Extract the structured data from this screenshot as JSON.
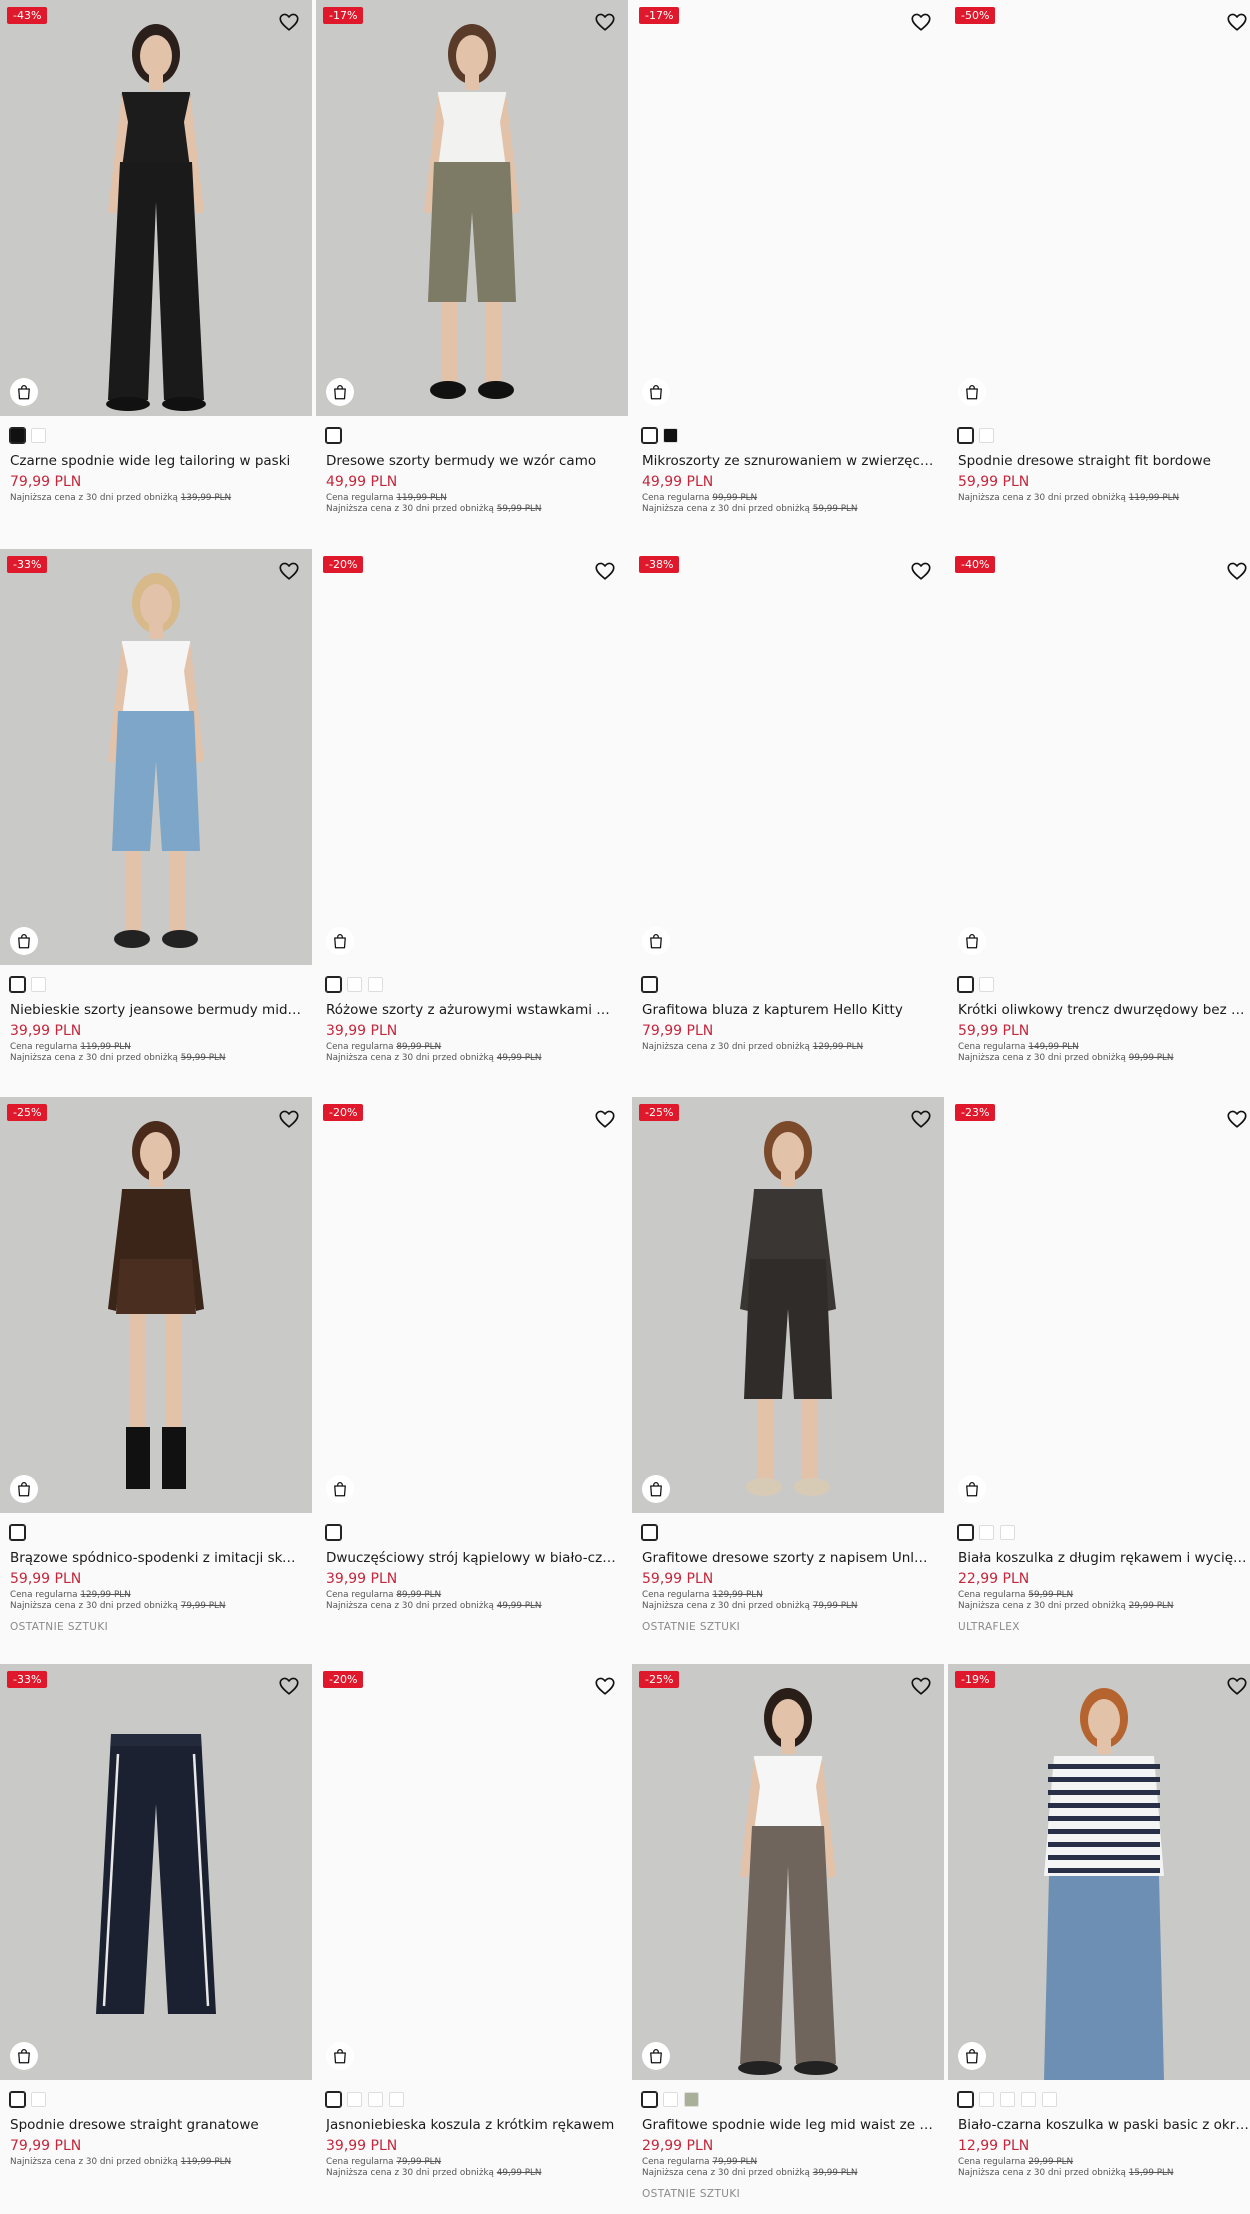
{
  "products": [
    {
      "discount": "-43%",
      "name": "Czarne spodnie wide leg tailoring w paski",
      "price": "79,99 PLN",
      "regular_label": "",
      "regular_price": "",
      "lowest_label": "Najniższa cena z 30 dni przed obniżką",
      "lowest_price": "139,99 PLN",
      "tag": "",
      "swatches": [
        "#111111",
        "#ffffff"
      ]
    },
    {
      "discount": "-17%",
      "name": "Dresowe szorty bermudy we wzór camo",
      "price": "49,99 PLN",
      "regular_label": "Cena regularna",
      "regular_price": "119,99 PLN",
      "lowest_label": "Najniższa cena z 30 dni przed obniżką",
      "lowest_price": "59,99 PLN",
      "tag": "",
      "swatches": [
        "#ffffff"
      ]
    },
    {
      "discount": "-17%",
      "name": "Mikroszorty ze sznurowaniem w zwierzęcy w...",
      "price": "49,99 PLN",
      "regular_label": "Cena regularna",
      "regular_price": "99,99 PLN",
      "lowest_label": "Najniższa cena z 30 dni przed obniżką",
      "lowest_price": "59,99 PLN",
      "tag": "",
      "swatches": [
        "#ffffff",
        "#111111"
      ]
    },
    {
      "discount": "-50%",
      "name": "Spodnie dresowe straight fit bordowe",
      "price": "59,99 PLN",
      "regular_label": "",
      "regular_price": "",
      "lowest_label": "Najniższa cena z 30 dni przed obniżką",
      "lowest_price": "119,99 PLN",
      "tag": "",
      "swatches": [
        "#ffffff",
        "#ffffff"
      ]
    },
    {
      "discount": "-33%",
      "name": "Niebieskie szorty jeansowe bermudy mid wa...",
      "price": "39,99 PLN",
      "regular_label": "Cena regularna",
      "regular_price": "119,99 PLN",
      "lowest_label": "Najniższa cena z 30 dni przed obniżką",
      "lowest_price": "59,99 PLN",
      "tag": "",
      "swatches": [
        "#ffffff",
        "#ffffff"
      ]
    },
    {
      "discount": "-20%",
      "name": "Różowe szorty z ażurowymi wstawkami mid ...",
      "price": "39,99 PLN",
      "regular_label": "Cena regularna",
      "regular_price": "89,99 PLN",
      "lowest_label": "Najniższa cena z 30 dni przed obniżką",
      "lowest_price": "49,99 PLN",
      "tag": "",
      "swatches": [
        "#ffffff",
        "#ffffff",
        "#ffffff"
      ]
    },
    {
      "discount": "-38%",
      "name": "Grafitowa bluza z kapturem Hello Kitty",
      "price": "79,99 PLN",
      "regular_label": "",
      "regular_price": "",
      "lowest_label": "Najniższa cena z 30 dni przed obniżką",
      "lowest_price": "129,99 PLN",
      "tag": "",
      "swatches": [
        "#ffffff"
      ]
    },
    {
      "discount": "-40%",
      "name": "Krótki oliwkowy trencz dwurzędowy bez po...",
      "price": "59,99 PLN",
      "regular_label": "Cena regularna",
      "regular_price": "149,99 PLN",
      "lowest_label": "Najniższa cena z 30 dni przed obniżką",
      "lowest_price": "99,99 PLN",
      "tag": "",
      "swatches": [
        "#ffffff",
        "#ffffff"
      ]
    },
    {
      "discount": "-25%",
      "name": "Brązowe spódnico-spodenki z imitacji skóry",
      "price": "59,99 PLN",
      "regular_label": "Cena regularna",
      "regular_price": "129,99 PLN",
      "lowest_label": "Najniższa cena z 30 dni przed obniżką",
      "lowest_price": "79,99 PLN",
      "tag": "OSTATNIE SZTUKI",
      "swatches": [
        "#ffffff"
      ]
    },
    {
      "discount": "-20%",
      "name": "Dwuczęściowy strój kąpielowy w biało-czerw...",
      "price": "39,99 PLN",
      "regular_label": "Cena regularna",
      "regular_price": "89,99 PLN",
      "lowest_label": "Najniższa cena z 30 dni przed obniżką",
      "lowest_price": "49,99 PLN",
      "tag": "",
      "swatches": [
        "#ffffff"
      ]
    },
    {
      "discount": "-25%",
      "name": "Grafitowe dresowe szorty z napisem Unleash",
      "price": "59,99 PLN",
      "regular_label": "Cena regularna",
      "regular_price": "129,99 PLN",
      "lowest_label": "Najniższa cena z 30 dni przed obniżką",
      "lowest_price": "79,99 PLN",
      "tag": "OSTATNIE SZTUKI",
      "swatches": [
        "#ffffff"
      ]
    },
    {
      "discount": "-23%",
      "name": "Biała koszulka z długim rękawem i wycięcie...",
      "price": "22,99 PLN",
      "regular_label": "Cena regularna",
      "regular_price": "59,99 PLN",
      "lowest_label": "Najniższa cena z 30 dni przed obniżką",
      "lowest_price": "29,99 PLN",
      "tag": "ULTRAFLEX",
      "swatches": [
        "#ffffff",
        "#ffffff",
        "#ffffff"
      ]
    },
    {
      "discount": "-33%",
      "name": "Spodnie dresowe straight granatowe",
      "price": "79,99 PLN",
      "regular_label": "",
      "regular_price": "",
      "lowest_label": "Najniższa cena z 30 dni przed obniżką",
      "lowest_price": "119,99 PLN",
      "tag": "",
      "swatches": [
        "#ffffff",
        "#ffffff"
      ]
    },
    {
      "discount": "-20%",
      "name": "Jasnoniebieska koszula z krótkim rękawem",
      "price": "39,99 PLN",
      "regular_label": "Cena regularna",
      "regular_price": "79,99 PLN",
      "lowest_label": "Najniższa cena z 30 dni przed obniżką",
      "lowest_price": "49,99 PLN",
      "tag": "",
      "swatches": [
        "#ffffff",
        "#ffffff",
        "#ffffff",
        "#ffffff"
      ]
    },
    {
      "discount": "-25%",
      "name": "Grafitowe spodnie wide leg mid waist ze str...",
      "price": "29,99 PLN",
      "regular_label": "Cena regularna",
      "regular_price": "79,99 PLN",
      "lowest_label": "Najniższa cena z 30 dni przed obniżką",
      "lowest_price": "39,99 PLN",
      "tag": "OSTATNIE SZTUKI",
      "swatches": [
        "#ffffff",
        "#ffffff",
        "#a8b09a"
      ]
    },
    {
      "discount": "-19%",
      "name": "Biało-czarna koszulka w paski basic z okrągły...",
      "price": "12,99 PLN",
      "regular_label": "Cena regularna",
      "regular_price": "29,99 PLN",
      "lowest_label": "Najniższa cena z 30 dni przed obniżką",
      "lowest_price": "15,99 PLN",
      "tag": "",
      "swatches": [
        "#ffffff",
        "#ffffff",
        "#ffffff",
        "#ffffff",
        "#ffffff"
      ]
    }
  ],
  "colors": {
    "badge": "#e0182b",
    "price": "#c4263b",
    "background": "#fafafa"
  },
  "icons": {
    "favorite": "heart-icon",
    "cart": "shopping-bag-icon"
  }
}
